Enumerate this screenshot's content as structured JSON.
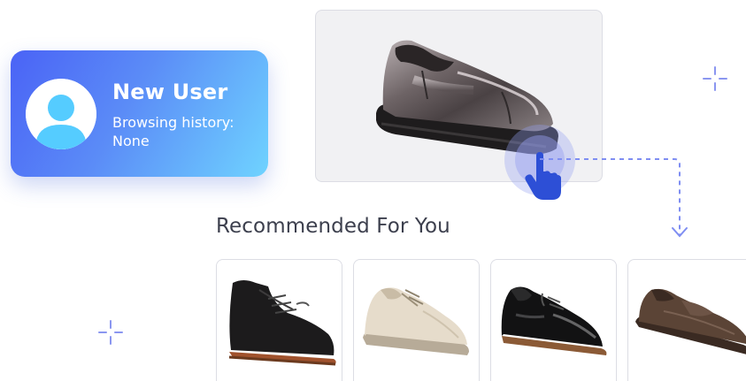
{
  "user": {
    "name": "New User",
    "history": "Browsing history: None"
  },
  "recommended": {
    "title": "Recommended For You",
    "items": [
      {
        "icon": "black-suede-chukka-boot-icon"
      },
      {
        "icon": "beige-leather-derby-shoe-icon"
      },
      {
        "icon": "black-patent-oxford-shoe-icon"
      },
      {
        "icon": "brown-leather-loafer-icon"
      }
    ]
  },
  "featured": {
    "icon": "metallic-slip-on-shoe-icon"
  },
  "colors": {
    "card_gradient_start": "#4a63f6",
    "card_gradient_end": "#6fd3ff",
    "accent": "#5b6cf0",
    "title_text": "#3c3f4d"
  }
}
